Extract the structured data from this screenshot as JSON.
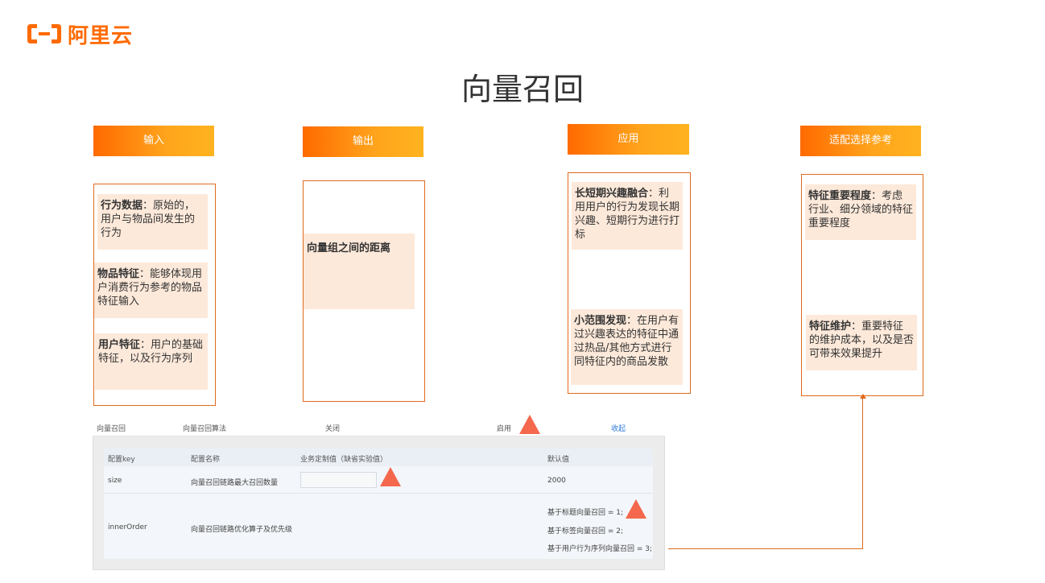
{
  "brand": {
    "name": "阿里云",
    "color": "#ff6a00"
  },
  "page": {
    "title": "向量召回"
  },
  "columns": {
    "input": {
      "header": "输入",
      "cards": [
        {
          "bold": "行为数据",
          "text": "：原始的，用户与物品间发生的行为"
        },
        {
          "bold": "物品特征",
          "text": "：能够体现用户消费行为参考的物品特征输入"
        },
        {
          "bold": "用户特征",
          "text": "：用户的基础特征，以及行为序列"
        }
      ]
    },
    "output": {
      "header": "输出",
      "cards": [
        {
          "bold": "向量组之间的距离",
          "text": ""
        }
      ]
    },
    "apply": {
      "header": "应用",
      "cards": [
        {
          "bold": "长短期兴趣融合",
          "text": "：利用用户的行为发现长期兴趣、短期行为进行打标"
        },
        {
          "bold": "小范围发现",
          "text": "：在用户有过兴趣表达的特征中通过热品/其他方式进行同特征内的商品发散"
        }
      ]
    },
    "ref": {
      "header": "适配选择参考",
      "cards": [
        {
          "bold": "特征重要程度",
          "text": "：考虑行业、细分领域的特征重要程度"
        },
        {
          "bold": "特征维护",
          "text": "：重要特征的维护成本，以及是否可带来效果提升"
        }
      ]
    }
  },
  "config": {
    "row": {
      "name": "向量召回",
      "algo": "向量召回算法",
      "off": "关闭",
      "on": "启用",
      "collapse": "收起"
    },
    "table": {
      "headers": [
        "配置key",
        "配置名称",
        "业务定制值（缺省实验值）",
        "默认值"
      ],
      "rows": [
        {
          "key": "size",
          "name": "向量召回链路最大召回数量",
          "default": "2000"
        },
        {
          "key": "innerOrder",
          "name": "向量召回链路优化算子及优先级",
          "defaults": [
            "基于标题向量召回 = 1;",
            "基于标签向量召回 = 2;",
            "基于用户行为序列向量召回 = 3;"
          ]
        }
      ]
    }
  },
  "colors": {
    "accent": "#ff6a00",
    "marker": "#f4684e",
    "card_bg": "#fde9da",
    "border": "#e06a1c",
    "link": "#2d7ad6"
  }
}
